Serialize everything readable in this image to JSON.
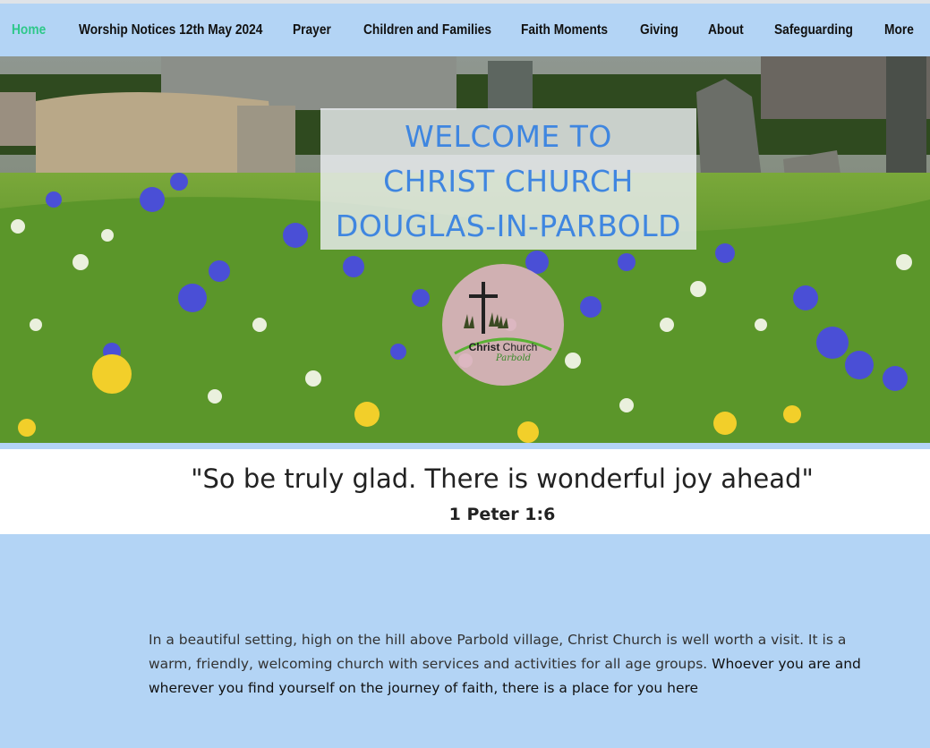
{
  "nav": {
    "items": [
      {
        "label": "Home",
        "active": true
      },
      {
        "label": "Worship Notices 12th May 2024",
        "active": false
      },
      {
        "label": "Prayer",
        "active": false
      },
      {
        "label": "Children and Families",
        "active": false
      },
      {
        "label": "Faith Moments",
        "active": false
      },
      {
        "label": "Giving",
        "active": false
      },
      {
        "label": "About",
        "active": false
      },
      {
        "label": "Safeguarding",
        "active": false
      },
      {
        "label": "More",
        "active": false
      }
    ]
  },
  "hero": {
    "welcome_lines": [
      "WELCOME TO",
      "CHRIST CHURCH",
      "DOUGLAS-IN-PARBOLD"
    ],
    "logo": {
      "name_bold": "Christ",
      "name_regular": "Church",
      "place": "Parbold"
    }
  },
  "quote": {
    "text": "\"So be truly glad. There is wonderful joy ahead\"",
    "reference": "1 Peter 1:6"
  },
  "intro": {
    "text": "In a beautiful setting, high on the hill above Parbold village, Christ Church is well worth a visit. It is a warm, friendly, welcoming church with services and activities for all age groups.",
    "emphasis": "Whoever you are and wherever you find yourself on the journey of faith, there is a place for you here"
  },
  "colors": {
    "nav_bg": "#b3d4f5",
    "nav_active": "#2fc88a",
    "welcome_text": "#3f86e0",
    "page_bg": "#b3d4f5"
  }
}
